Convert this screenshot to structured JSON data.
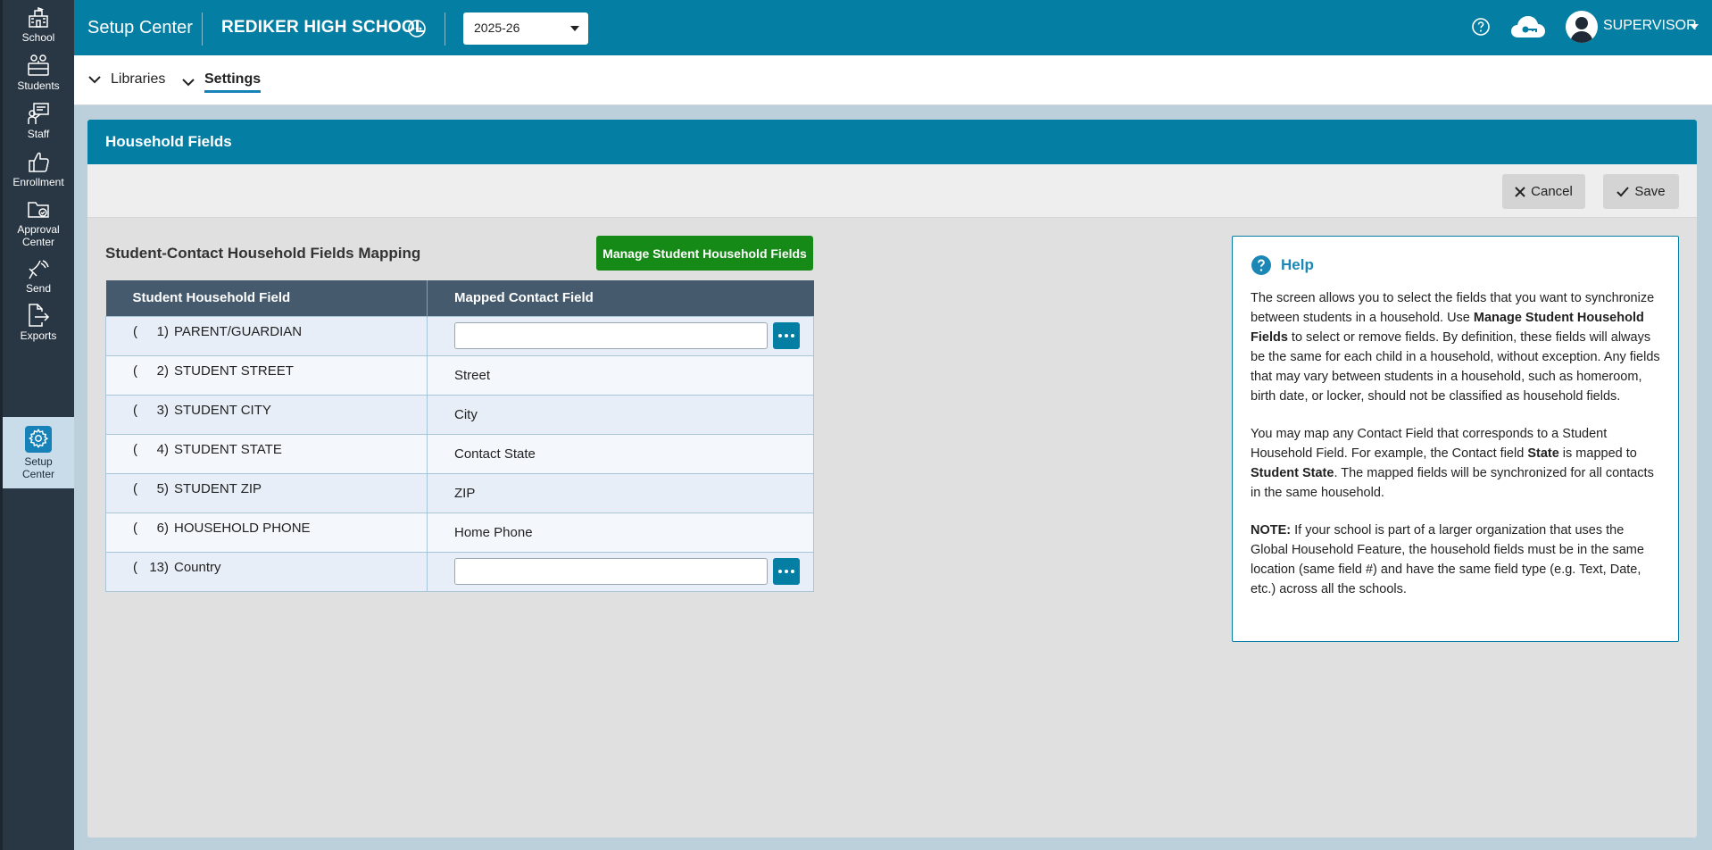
{
  "nav": [
    {
      "label": "School",
      "icon": "school-icon"
    },
    {
      "label": "Students",
      "icon": "students-icon"
    },
    {
      "label": "Staff",
      "icon": "staff-icon"
    },
    {
      "label": "Enrollment",
      "icon": "enrollment-icon"
    },
    {
      "label_line1": "Approval",
      "label_line2": "Center",
      "icon": "approval-center-icon"
    },
    {
      "label": "Send",
      "icon": "send-icon"
    },
    {
      "label": "Exports",
      "icon": "exports-icon"
    },
    {
      "label_line1": "Setup",
      "label_line2": "Center",
      "icon": "gear-icon",
      "active": true
    }
  ],
  "topbar": {
    "app_title": "Setup Center",
    "school_name": "REDIKER HIGH SCHOOL",
    "school_year": "2025-26",
    "user": "SUPERVISOR"
  },
  "subtabs": [
    {
      "label": "Libraries"
    },
    {
      "label": "Settings",
      "active": true
    }
  ],
  "panel": {
    "title": "Household Fields",
    "cancel_label": "Cancel",
    "save_label": "Save"
  },
  "mapping": {
    "title": "Student-Contact Household Fields Mapping",
    "manage_button": "Manage Student Household Fields",
    "col1_header": "Student Household Field",
    "col2_header": "Mapped Contact Field",
    "rows": [
      {
        "paren": "(",
        "num": "1)",
        "field": "PARENT/GUARDIAN",
        "mapped": "",
        "editable": true
      },
      {
        "paren": "(",
        "num": "2)",
        "field": "STUDENT STREET",
        "mapped": "Street",
        "editable": false
      },
      {
        "paren": "(",
        "num": "3)",
        "field": "STUDENT CITY",
        "mapped": "City",
        "editable": false
      },
      {
        "paren": "(",
        "num": "4)",
        "field": "STUDENT STATE",
        "mapped": "Contact State",
        "editable": false
      },
      {
        "paren": "(",
        "num": "5)",
        "field": "STUDENT ZIP",
        "mapped": "ZIP",
        "editable": false
      },
      {
        "paren": "(",
        "num": "6)",
        "field": "HOUSEHOLD PHONE",
        "mapped": "Home Phone",
        "editable": false
      },
      {
        "paren": "(",
        "num": "13)",
        "field": "Country",
        "mapped": "",
        "editable": true
      }
    ]
  },
  "help": {
    "title": "Help",
    "p1_a": "The screen allows you to select the fields that you want to synchronize between students in a household. Use ",
    "p1_b": "Manage Student Household Fields",
    "p1_c": " to select or remove fields. By definition, these fields will always be the same for each child in a household, without exception. Any fields that may vary between students in a household, such as homeroom, birth date, or locker, should not be classified as household fields.",
    "p2_a": "You may map any Contact Field that corresponds to a Student Household Field. For example, the Contact field ",
    "p2_b": "State",
    "p2_c": " is mapped to ",
    "p2_d": "Student State",
    "p2_e": ". The mapped fields will be synchronized for all contacts in the same household.",
    "p3_a": "NOTE:",
    "p3_b": " If your school is part of a larger organization that uses the Global Household Feature, the household fields must be in the same location (same field #) and have the same field type (e.g. Text, Date, etc.) across all the schools."
  },
  "colors": {
    "brand": "#047fa3",
    "nav_bg": "#293745",
    "manage_green": "#168a16",
    "table_header": "#455a6c"
  }
}
